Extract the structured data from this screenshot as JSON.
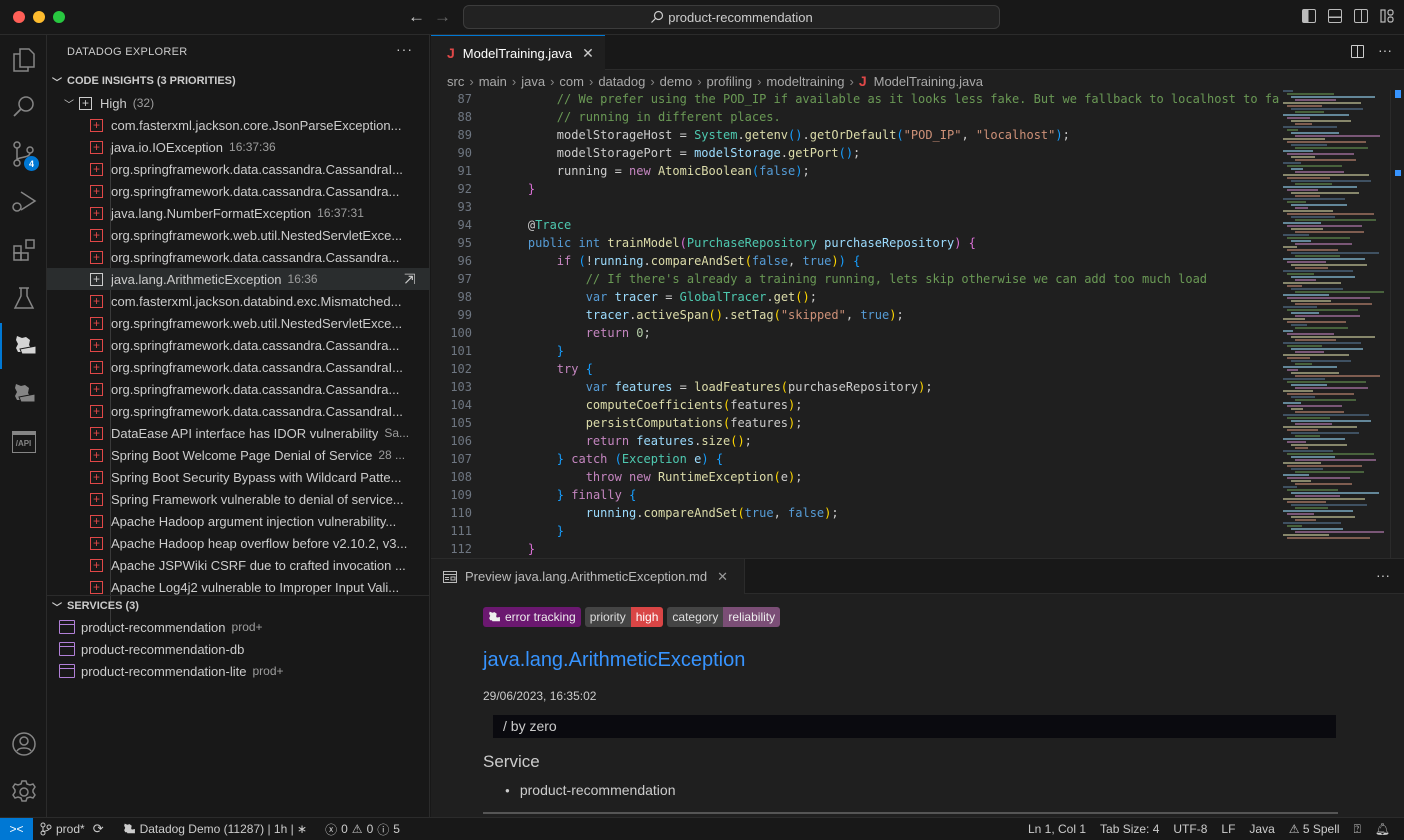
{
  "window": {
    "search_text": "product-recommendation",
    "nav_back": "←",
    "nav_forward": "→"
  },
  "activity_bar": {
    "items": [
      {
        "name": "explorer",
        "icon": "files-icon"
      },
      {
        "name": "search",
        "icon": "search-icon"
      },
      {
        "name": "source-control",
        "icon": "source-control-icon",
        "badge": "4"
      },
      {
        "name": "run-debug",
        "icon": "debug-icon"
      },
      {
        "name": "extensions",
        "icon": "extensions-icon"
      },
      {
        "name": "testing",
        "icon": "flask-icon"
      },
      {
        "name": "datadog",
        "icon": "datadog-icon",
        "active": true
      },
      {
        "name": "datadog-2",
        "icon": "datadog-icon"
      },
      {
        "name": "api",
        "icon": "api-icon",
        "label": "/API"
      }
    ],
    "bottom": [
      {
        "name": "accounts",
        "icon": "account-icon"
      },
      {
        "name": "manage",
        "icon": "gear-icon"
      }
    ]
  },
  "sidebar": {
    "title": "DATADOG EXPLORER",
    "more": "···",
    "code_insights": {
      "header": "CODE INSIGHTS (3 PRIORITIES)",
      "group": {
        "label": "High",
        "count": "(32)"
      },
      "items": [
        {
          "label": "com.fasterxml.jackson.core.JsonParseException...",
          "desc": ""
        },
        {
          "label": "java.io.IOException",
          "desc": "16:37:36"
        },
        {
          "label": "org.springframework.data.cassandra.CassandraI...",
          "desc": ""
        },
        {
          "label": "org.springframework.data.cassandra.Cassandra...",
          "desc": ""
        },
        {
          "label": "java.lang.NumberFormatException",
          "desc": "16:37:31"
        },
        {
          "label": "org.springframework.web.util.NestedServletExce...",
          "desc": ""
        },
        {
          "label": "org.springframework.data.cassandra.Cassandra...",
          "desc": ""
        },
        {
          "label": "java.lang.ArithmeticException",
          "desc": "16:36",
          "selected": true
        },
        {
          "label": "com.fasterxml.jackson.databind.exc.Mismatched...",
          "desc": ""
        },
        {
          "label": "org.springframework.web.util.NestedServletExce...",
          "desc": ""
        },
        {
          "label": "org.springframework.data.cassandra.Cassandra...",
          "desc": ""
        },
        {
          "label": "org.springframework.data.cassandra.CassandraI...",
          "desc": ""
        },
        {
          "label": "org.springframework.data.cassandra.Cassandra...",
          "desc": ""
        },
        {
          "label": "org.springframework.data.cassandra.CassandraI...",
          "desc": ""
        },
        {
          "label": "DataEase API interface has IDOR vulnerability",
          "desc": "Sa..."
        },
        {
          "label": "Spring Boot Welcome Page Denial of Service",
          "desc": "28 ..."
        },
        {
          "label": "Spring Boot Security Bypass with Wildcard Patte...",
          "desc": ""
        },
        {
          "label": "Spring Framework vulnerable to denial of service...",
          "desc": ""
        },
        {
          "label": "Apache Hadoop argument injection vulnerability...",
          "desc": ""
        },
        {
          "label": "Apache Hadoop heap overflow before v2.10.2, v3...",
          "desc": ""
        },
        {
          "label": "Apache JSPWiki CSRF due to crafted invocation ...",
          "desc": ""
        },
        {
          "label": "Apache Log4j2 vulnerable to Improper Input Vali...",
          "desc": ""
        }
      ]
    },
    "services": {
      "header": "SERVICES (3)",
      "items": [
        {
          "label": "product-recommendation",
          "desc": "prod+"
        },
        {
          "label": "product-recommendation-db",
          "desc": ""
        },
        {
          "label": "product-recommendation-lite",
          "desc": "prod+"
        }
      ]
    }
  },
  "editor": {
    "tab": {
      "label": "ModelTraining.java",
      "icon": "J"
    },
    "breadcrumb": [
      "src",
      "main",
      "java",
      "com",
      "datadog",
      "demo",
      "profiling",
      "modeltraining",
      "ModelTraining.java"
    ],
    "lines": [
      {
        "n": "87",
        "indent": 2,
        "tokens": [
          [
            "c-com",
            "// We prefer using the POD_IP if available as it looks less fake. But we fallback to localhost to fa"
          ]
        ]
      },
      {
        "n": "88",
        "indent": 2,
        "tokens": [
          [
            "c-com",
            "// running in different places."
          ]
        ]
      },
      {
        "n": "89",
        "indent": 2,
        "tokens": [
          [
            "c-def",
            "modelStorageHost = "
          ],
          [
            "c-ty",
            "System"
          ],
          [
            "c-def",
            "."
          ],
          [
            "c-fn",
            "getenv"
          ],
          [
            "c-p3",
            "()"
          ],
          [
            "c-def",
            "."
          ],
          [
            "c-fn",
            "getOrDefault"
          ],
          [
            "c-p3",
            "("
          ],
          [
            "c-str",
            "\"POD_IP\""
          ],
          [
            "c-def",
            ", "
          ],
          [
            "c-str",
            "\"localhost\""
          ],
          [
            "c-p3",
            ")"
          ],
          [
            "c-def",
            ";"
          ]
        ]
      },
      {
        "n": "90",
        "indent": 2,
        "tokens": [
          [
            "c-def",
            "modelStoragePort = "
          ],
          [
            "c-var",
            "modelStorage"
          ],
          [
            "c-def",
            "."
          ],
          [
            "c-fn",
            "getPort"
          ],
          [
            "c-p3",
            "()"
          ],
          [
            "c-def",
            ";"
          ]
        ]
      },
      {
        "n": "91",
        "indent": 2,
        "tokens": [
          [
            "c-def",
            "running = "
          ],
          [
            "c-ctrl",
            "new "
          ],
          [
            "c-fn",
            "AtomicBoolean"
          ],
          [
            "c-p3",
            "("
          ],
          [
            "c-kw",
            "false"
          ],
          [
            "c-p3",
            ")"
          ],
          [
            "c-def",
            ";"
          ]
        ]
      },
      {
        "n": "92",
        "indent": 1,
        "tokens": [
          [
            "c-p2",
            "}"
          ]
        ]
      },
      {
        "n": "93",
        "indent": 0,
        "tokens": []
      },
      {
        "n": "94",
        "indent": 1,
        "tokens": [
          [
            "c-def",
            "@"
          ],
          [
            "c-ty",
            "Trace"
          ]
        ]
      },
      {
        "n": "95",
        "indent": 1,
        "tokens": [
          [
            "c-kw",
            "public int "
          ],
          [
            "c-fn",
            "trainModel"
          ],
          [
            "c-p2",
            "("
          ],
          [
            "c-ty",
            "PurchaseRepository "
          ],
          [
            "c-var",
            "purchaseRepository"
          ],
          [
            "c-p2",
            ")"
          ],
          [
            "c-def",
            " "
          ],
          [
            "c-p2",
            "{"
          ]
        ]
      },
      {
        "n": "96",
        "indent": 2,
        "tokens": [
          [
            "c-ctrl",
            "if "
          ],
          [
            "c-p3",
            "("
          ],
          [
            "c-def",
            "!"
          ],
          [
            "c-var",
            "running"
          ],
          [
            "c-def",
            "."
          ],
          [
            "c-fn",
            "compareAndSet"
          ],
          [
            "c-p1",
            "("
          ],
          [
            "c-kw",
            "false"
          ],
          [
            "c-def",
            ", "
          ],
          [
            "c-kw",
            "true"
          ],
          [
            "c-p1",
            ")"
          ],
          [
            "c-p3",
            ")"
          ],
          [
            "c-def",
            " "
          ],
          [
            "c-p3",
            "{"
          ]
        ]
      },
      {
        "n": "97",
        "indent": 3,
        "tokens": [
          [
            "c-com",
            "// If there's already a training running, lets skip otherwise we can add too much load"
          ]
        ]
      },
      {
        "n": "98",
        "indent": 3,
        "tokens": [
          [
            "c-kw",
            "var "
          ],
          [
            "c-var",
            "tracer"
          ],
          [
            "c-def",
            " = "
          ],
          [
            "c-ty",
            "GlobalTracer"
          ],
          [
            "c-def",
            "."
          ],
          [
            "c-fn",
            "get"
          ],
          [
            "c-p1",
            "()"
          ],
          [
            "c-def",
            ";"
          ]
        ]
      },
      {
        "n": "99",
        "indent": 3,
        "tokens": [
          [
            "c-var",
            "tracer"
          ],
          [
            "c-def",
            "."
          ],
          [
            "c-fn",
            "activeSpan"
          ],
          [
            "c-p1",
            "()"
          ],
          [
            "c-def",
            "."
          ],
          [
            "c-fn",
            "setTag"
          ],
          [
            "c-p1",
            "("
          ],
          [
            "c-str",
            "\"skipped\""
          ],
          [
            "c-def",
            ", "
          ],
          [
            "c-kw",
            "true"
          ],
          [
            "c-p1",
            ")"
          ],
          [
            "c-def",
            ";"
          ]
        ]
      },
      {
        "n": "100",
        "indent": 3,
        "tokens": [
          [
            "c-ctrl",
            "return "
          ],
          [
            "c-num",
            "0"
          ],
          [
            "c-def",
            ";"
          ]
        ]
      },
      {
        "n": "101",
        "indent": 2,
        "tokens": [
          [
            "c-p3",
            "}"
          ]
        ]
      },
      {
        "n": "102",
        "indent": 2,
        "tokens": [
          [
            "c-ctrl",
            "try "
          ],
          [
            "c-p3",
            "{"
          ]
        ]
      },
      {
        "n": "103",
        "indent": 3,
        "tokens": [
          [
            "c-kw",
            "var "
          ],
          [
            "c-var",
            "features"
          ],
          [
            "c-def",
            " = "
          ],
          [
            "c-fn",
            "loadFeatures"
          ],
          [
            "c-p1",
            "("
          ],
          [
            "c-def",
            "purchaseRepository"
          ],
          [
            "c-p1",
            ")"
          ],
          [
            "c-def",
            ";"
          ]
        ]
      },
      {
        "n": "104",
        "indent": 3,
        "tokens": [
          [
            "c-fn",
            "computeCoefficients"
          ],
          [
            "c-p1",
            "("
          ],
          [
            "c-def",
            "features"
          ],
          [
            "c-p1",
            ")"
          ],
          [
            "c-def",
            ";"
          ]
        ]
      },
      {
        "n": "105",
        "indent": 3,
        "tokens": [
          [
            "c-fn",
            "persistComputations"
          ],
          [
            "c-p1",
            "("
          ],
          [
            "c-def",
            "features"
          ],
          [
            "c-p1",
            ")"
          ],
          [
            "c-def",
            ";"
          ]
        ]
      },
      {
        "n": "106",
        "indent": 3,
        "tokens": [
          [
            "c-ctrl",
            "return "
          ],
          [
            "c-var",
            "features"
          ],
          [
            "c-def",
            "."
          ],
          [
            "c-fn",
            "size"
          ],
          [
            "c-p1",
            "()"
          ],
          [
            "c-def",
            ";"
          ]
        ]
      },
      {
        "n": "107",
        "indent": 2,
        "tokens": [
          [
            "c-p3",
            "}"
          ],
          [
            "c-def",
            " "
          ],
          [
            "c-ctrl",
            "catch "
          ],
          [
            "c-p3",
            "("
          ],
          [
            "c-ty",
            "Exception "
          ],
          [
            "c-var",
            "e"
          ],
          [
            "c-p3",
            ")"
          ],
          [
            "c-def",
            " "
          ],
          [
            "c-p3",
            "{"
          ]
        ]
      },
      {
        "n": "108",
        "indent": 3,
        "tokens": [
          [
            "c-ctrl",
            "throw new "
          ],
          [
            "c-fn",
            "RuntimeException"
          ],
          [
            "c-p1",
            "("
          ],
          [
            "c-def",
            "e"
          ],
          [
            "c-p1",
            ")"
          ],
          [
            "c-def",
            ";"
          ]
        ]
      },
      {
        "n": "109",
        "indent": 2,
        "tokens": [
          [
            "c-p3",
            "}"
          ],
          [
            "c-def",
            " "
          ],
          [
            "c-ctrl",
            "finally "
          ],
          [
            "c-p3",
            "{"
          ]
        ]
      },
      {
        "n": "110",
        "indent": 3,
        "tokens": [
          [
            "c-var",
            "running"
          ],
          [
            "c-def",
            "."
          ],
          [
            "c-fn",
            "compareAndSet"
          ],
          [
            "c-p1",
            "("
          ],
          [
            "c-kw",
            "true"
          ],
          [
            "c-def",
            ", "
          ],
          [
            "c-kw",
            "false"
          ],
          [
            "c-p1",
            ")"
          ],
          [
            "c-def",
            ";"
          ]
        ]
      },
      {
        "n": "111",
        "indent": 2,
        "tokens": [
          [
            "c-p3",
            "}"
          ]
        ]
      },
      {
        "n": "112",
        "indent": 1,
        "tokens": [
          [
            "c-p2",
            "}"
          ]
        ]
      }
    ]
  },
  "preview": {
    "tab_label": "Preview java.lang.ArithmeticException.md",
    "more": "···",
    "tags": {
      "error_tracking": "error tracking",
      "priority_key": "priority",
      "priority_value": "high",
      "category_key": "category",
      "category_value": "reliability"
    },
    "colors": {
      "error_tracking": "#6b1870",
      "priority_high": "#d94545",
      "category_reliability": "#7b4e76",
      "tag_key": "#444444",
      "link": "#3794ff"
    },
    "title": "java.lang.ArithmeticException",
    "timestamp": "29/06/2023, 16:35:02",
    "message": "/ by zero",
    "service_heading": "Service",
    "services": [
      "product-recommendation"
    ]
  },
  "statusbar": {
    "branch": "prod*",
    "datadog": "Datadog Demo (11287) | 1h | ∗",
    "errors": "0",
    "warnings": "0",
    "info": "5",
    "position": "Ln 1, Col 1",
    "tab_size": "Tab Size: 4",
    "encoding": "UTF-8",
    "eol": "LF",
    "language": "Java",
    "spell": "5 Spell"
  }
}
